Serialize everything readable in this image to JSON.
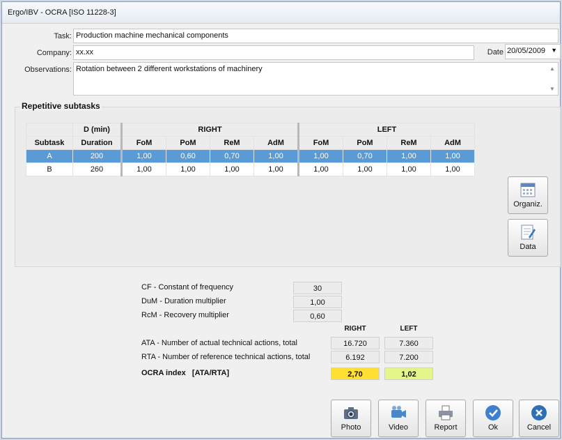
{
  "window": {
    "title": "Ergo/IBV - OCRA [ISO 11228-3]"
  },
  "form": {
    "task_label": "Task:",
    "task_value": "Production machine mechanical components",
    "company_label": "Company:",
    "company_value": "xx.xx",
    "date_label": "Date",
    "date_value": "20/05/2009",
    "observations_label": "Observations:",
    "observations_value": "Rotation between 2 different workstations of machinery"
  },
  "subtasks": {
    "title": "Repetitive subtasks",
    "headers": {
      "subtask": "Subtask",
      "d_min": "D (min)",
      "duration": "Duration",
      "right": "RIGHT",
      "left": "LEFT",
      "fom": "FoM",
      "pom": "PoM",
      "rem": "ReM",
      "adm": "AdM"
    },
    "rows": [
      {
        "subtask": "A",
        "duration": "200",
        "r_fom": "1,00",
        "r_pom": "0,60",
        "r_rem": "0,70",
        "r_adm": "1,00",
        "l_fom": "1,00",
        "l_pom": "0,70",
        "l_rem": "1,00",
        "l_adm": "1,00"
      },
      {
        "subtask": "B",
        "duration": "260",
        "r_fom": "1,00",
        "r_pom": "1,00",
        "r_rem": "1,00",
        "r_adm": "1,00",
        "l_fom": "1,00",
        "l_pom": "1,00",
        "l_rem": "1,00",
        "l_adm": "1,00"
      }
    ],
    "organiz_label": "Organiz.",
    "data_label": "Data"
  },
  "summary": {
    "cf_label": "CF - Constant of frequency",
    "cf_value": "30",
    "dum_label": "DuM - Duration multiplier",
    "dum_value": "1,00",
    "rcm_label": "RcM - Recovery multiplier",
    "rcm_value": "0,60",
    "right_header": "RIGHT",
    "left_header": "LEFT",
    "ata_label": "ATA - Number of actual technical actions, total",
    "ata_right": "16.720",
    "ata_left": "7.360",
    "rta_label": "RTA - Number of reference technical actions, total",
    "rta_right": "6.192",
    "rta_left": "7.200",
    "ocra_label": "OCRA index   [ATA/RTA]",
    "ocra_right": "2,70",
    "ocra_left": "1,02",
    "ocra_right_color": "#ffe033",
    "ocra_left_color": "#e4f58a"
  },
  "buttons": {
    "photo": "Photo",
    "video": "Video",
    "report": "Report",
    "ok": "Ok",
    "cancel": "Cancel"
  },
  "colors": {
    "selection": "#5b9bd5",
    "ok_icon": "#3f7fd0",
    "cancel_icon": "#2f6fb5"
  }
}
